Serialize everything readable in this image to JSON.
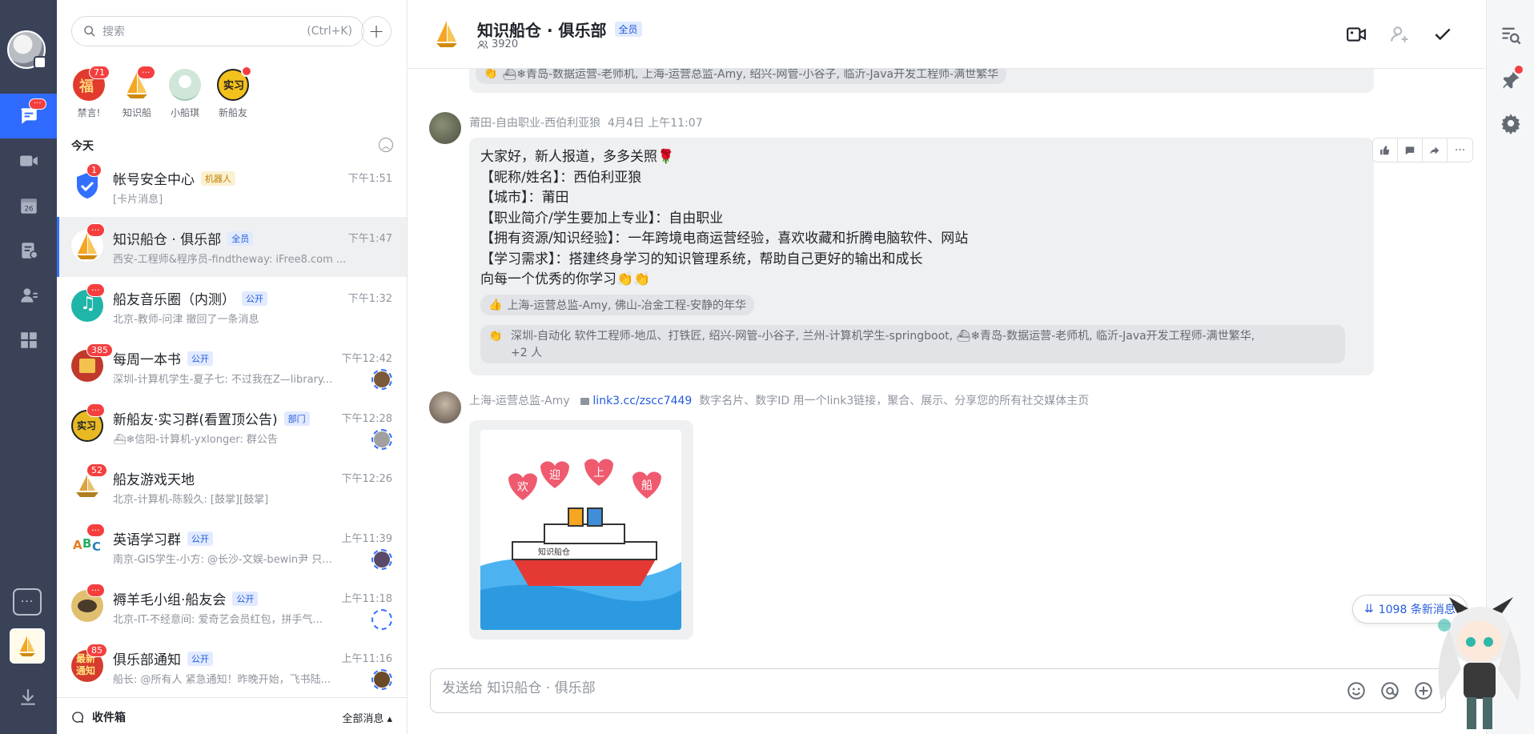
{
  "search": {
    "placeholder": "搜索",
    "shortcut": "(Ctrl+K)"
  },
  "pinned": [
    {
      "label": "禁言!",
      "badge": "71",
      "color": "#e23b2e"
    },
    {
      "label": "知识船",
      "badge": "···",
      "color": "#f5a623"
    },
    {
      "label": "小船琪",
      "badge": "",
      "color": "#cfe6d8"
    },
    {
      "label": "新船友",
      "badge": "",
      "color": "#f3c11b"
    }
  ],
  "section_today": "今天",
  "chats": [
    {
      "name": "帐号安全中心",
      "tag": "机器人",
      "tag_type": "bot",
      "time": "下午1:51",
      "preview": "[卡片消息]",
      "badge": "1",
      "color": "#3370ff",
      "mini": ""
    },
    {
      "name": "知识船仓 · 俱乐部",
      "tag": "全员",
      "tag_type": "pub",
      "time": "下午1:47",
      "preview": "西安-工程师&程序员-findtheway: iFree8.com ...",
      "badge": "···",
      "color": "#f5a623",
      "mini": ""
    },
    {
      "name": "船友音乐圈（内测）",
      "tag": "公开",
      "tag_type": "pub",
      "time": "下午1:32",
      "preview": "北京-教师-问津 撤回了一条消息",
      "badge": "···",
      "color": "#1fb5a8",
      "mini": ""
    },
    {
      "name": "每周一本书",
      "tag": "公开",
      "tag_type": "pub",
      "time": "下午12:42",
      "preview": "深圳-计算机学生-夏子七: 不过我在Z—library...",
      "badge": "385",
      "color": "#c0392b",
      "mini": "#7a5a3a"
    },
    {
      "name": "新船友·实习群(看置顶公告)",
      "tag": "部门",
      "tag_type": "pub",
      "time": "下午12:28",
      "preview": "⛴❄信阳-计算机-yxlonger: 群公告",
      "badge": "···",
      "color": "#e8b923",
      "mini": "#a0a0a0"
    },
    {
      "name": "船友游戏天地",
      "tag": "",
      "tag_type": "",
      "time": "下午12:26",
      "preview": "北京-计算机-陈毅久: [鼓掌][鼓掌]",
      "badge": "52",
      "color": "#d9a441",
      "mini": ""
    },
    {
      "name": "英语学习群",
      "tag": "公开",
      "tag_type": "pub",
      "time": "上午11:39",
      "preview": "南京-GIS学生-小方: @长沙-文娱-bewin尹 只...",
      "badge": "···",
      "color": "#f2c94c",
      "mini": "#5a4a6a"
    },
    {
      "name": "褥羊毛小组·船友会",
      "tag": "公开",
      "tag_type": "pub",
      "time": "上午11:18",
      "preview": "北京-IT-不经意间: 爱奇艺会员红包，拼手气...",
      "badge": "···",
      "color": "#e0c070",
      "mini": "#ffffff"
    },
    {
      "name": "俱乐部通知",
      "tag": "公开",
      "tag_type": "pub",
      "time": "上午11:16",
      "preview": "船长: @所有人 紧急通知！昨晚开始，飞书陆...",
      "badge": "85",
      "color": "#d63b2f",
      "mini": "#6b4a2a"
    }
  ],
  "list_footer": {
    "inbox": "收件箱",
    "filter": "全部消息"
  },
  "header": {
    "title": "知识船仓 · 俱乐部",
    "tag": "全员",
    "members": "3920"
  },
  "top_reaction": "⛴❄青岛-数据运营-老师机, 上海-运营总监-Amy, 绍兴-网管-小谷子, 临沂-Java开发工程师-满世繁华",
  "message1": {
    "sender": "莆田-自由职业-西伯利亚狼",
    "time": "4月4日 上午11:07",
    "lines": [
      "大家好，新人报道，多多关照🌹",
      "【昵称/姓名】：西伯利亚狼",
      "【城市】：莆田",
      "【职业简介/学生要加上专业】：自由职业",
      "【拥有资源/知识经验】：一年跨境电商运营经验，喜欢收藏和折腾电脑软件、网站",
      "【学习需求】：搭建终身学习的知识管理系统，帮助自己更好的输出和成长",
      "向每一个优秀的你学习👏👏"
    ],
    "reaction_like": "上海-运营总监-Amy, 佛山-冶金工程-安静的年华",
    "reaction_clap": "深圳-自动化 软件工程师-地瓜、打铁匠, 绍兴-网管-小谷子, 兰州-计算机学生-springboot, ⛴❄青岛-数据运营-老师机, 临沂-Java开发工程师-满世繁华,",
    "reaction_more": "+2 人"
  },
  "message2": {
    "sender": "上海-运营总监-Amy",
    "link": "link3.cc/zscc7449",
    "desc": "数字名片、数字ID 用一个link3链接，聚合、展示、分享您的所有社交媒体主页",
    "sticker_text": [
      "欢",
      "迎",
      "上",
      "船"
    ],
    "ship_text": "知识船仓"
  },
  "new_messages": "1098 条新消息",
  "composer": {
    "placeholder": "发送给 知识船仓 · 俱乐部"
  },
  "colors": {
    "accent": "#3370ff",
    "rail": "#3a4258",
    "badge": "#f53f3f"
  }
}
